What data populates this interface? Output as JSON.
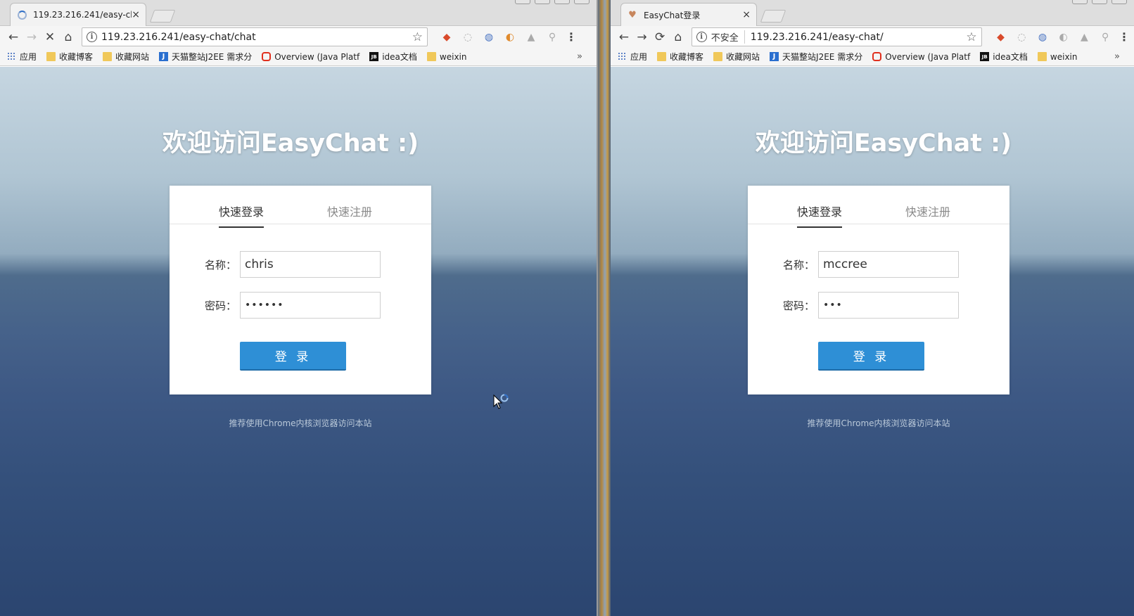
{
  "left": {
    "tab_title": "119.23.216.241/easy-ch",
    "tab_close": "×",
    "url": "119.23.216.241/easy-chat/chat",
    "welcome": "欢迎访问EasyChat :)",
    "tabs": [
      "快速登录",
      "快速注册"
    ],
    "name_label": "名称：",
    "name_value": "chris",
    "password_label": "密码：",
    "password_value": "••••••",
    "login_button": "登 录",
    "footnote": "推荐使用Chrome内核浏览器访问本站"
  },
  "right": {
    "tab_title": "EasyChat登录",
    "tab_close": "×",
    "not_secure": "不安全",
    "url": "119.23.216.241/easy-chat/",
    "welcome": "欢迎访问EasyChat :)",
    "tabs": [
      "快速登录",
      "快速注册"
    ],
    "name_label": "名称：",
    "name_value": "mccree",
    "password_label": "密码：",
    "password_value": "•••",
    "login_button": "登 录",
    "footnote": "推荐使用Chrome内核浏览器访问本站"
  },
  "bookmarks": [
    {
      "label": "应用",
      "icon": "apps-icon"
    },
    {
      "label": "收藏博客",
      "icon": "folder-icon"
    },
    {
      "label": "收藏网站",
      "icon": "folder-icon"
    },
    {
      "label": "天猫整站J2EE 需求分",
      "icon": "jiira-icon"
    },
    {
      "label": "Overview (Java Platf",
      "icon": "oracle-icon"
    },
    {
      "label": "idea文档",
      "icon": "jb-icon"
    },
    {
      "label": "weixin",
      "icon": "folder-icon"
    }
  ],
  "bookmarks_more": "»",
  "icon_glyphs": {
    "back": "←",
    "forward": "→",
    "stop": "✕",
    "reload": "⟳",
    "home": "⌂",
    "star": "☆",
    "menu": "⋮"
  },
  "colors": {
    "login_button": "#2e8fd6",
    "sea_top": "#c6d6e1",
    "sea_bottom": "#2b4570"
  }
}
